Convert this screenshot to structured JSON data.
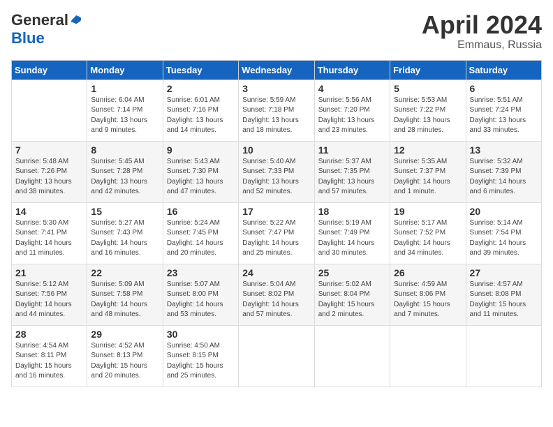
{
  "header": {
    "logo_general": "General",
    "logo_blue": "Blue",
    "title": "April 2024",
    "location": "Emmaus, Russia"
  },
  "calendar": {
    "days_of_week": [
      "Sunday",
      "Monday",
      "Tuesday",
      "Wednesday",
      "Thursday",
      "Friday",
      "Saturday"
    ],
    "weeks": [
      [
        {
          "day": "",
          "info": ""
        },
        {
          "day": "1",
          "info": "Sunrise: 6:04 AM\nSunset: 7:14 PM\nDaylight: 13 hours\nand 9 minutes."
        },
        {
          "day": "2",
          "info": "Sunrise: 6:01 AM\nSunset: 7:16 PM\nDaylight: 13 hours\nand 14 minutes."
        },
        {
          "day": "3",
          "info": "Sunrise: 5:59 AM\nSunset: 7:18 PM\nDaylight: 13 hours\nand 18 minutes."
        },
        {
          "day": "4",
          "info": "Sunrise: 5:56 AM\nSunset: 7:20 PM\nDaylight: 13 hours\nand 23 minutes."
        },
        {
          "day": "5",
          "info": "Sunrise: 5:53 AM\nSunset: 7:22 PM\nDaylight: 13 hours\nand 28 minutes."
        },
        {
          "day": "6",
          "info": "Sunrise: 5:51 AM\nSunset: 7:24 PM\nDaylight: 13 hours\nand 33 minutes."
        }
      ],
      [
        {
          "day": "7",
          "info": "Sunrise: 5:48 AM\nSunset: 7:26 PM\nDaylight: 13 hours\nand 38 minutes."
        },
        {
          "day": "8",
          "info": "Sunrise: 5:45 AM\nSunset: 7:28 PM\nDaylight: 13 hours\nand 42 minutes."
        },
        {
          "day": "9",
          "info": "Sunrise: 5:43 AM\nSunset: 7:30 PM\nDaylight: 13 hours\nand 47 minutes."
        },
        {
          "day": "10",
          "info": "Sunrise: 5:40 AM\nSunset: 7:33 PM\nDaylight: 13 hours\nand 52 minutes."
        },
        {
          "day": "11",
          "info": "Sunrise: 5:37 AM\nSunset: 7:35 PM\nDaylight: 13 hours\nand 57 minutes."
        },
        {
          "day": "12",
          "info": "Sunrise: 5:35 AM\nSunset: 7:37 PM\nDaylight: 14 hours\nand 1 minute."
        },
        {
          "day": "13",
          "info": "Sunrise: 5:32 AM\nSunset: 7:39 PM\nDaylight: 14 hours\nand 6 minutes."
        }
      ],
      [
        {
          "day": "14",
          "info": "Sunrise: 5:30 AM\nSunset: 7:41 PM\nDaylight: 14 hours\nand 11 minutes."
        },
        {
          "day": "15",
          "info": "Sunrise: 5:27 AM\nSunset: 7:43 PM\nDaylight: 14 hours\nand 16 minutes."
        },
        {
          "day": "16",
          "info": "Sunrise: 5:24 AM\nSunset: 7:45 PM\nDaylight: 14 hours\nand 20 minutes."
        },
        {
          "day": "17",
          "info": "Sunrise: 5:22 AM\nSunset: 7:47 PM\nDaylight: 14 hours\nand 25 minutes."
        },
        {
          "day": "18",
          "info": "Sunrise: 5:19 AM\nSunset: 7:49 PM\nDaylight: 14 hours\nand 30 minutes."
        },
        {
          "day": "19",
          "info": "Sunrise: 5:17 AM\nSunset: 7:52 PM\nDaylight: 14 hours\nand 34 minutes."
        },
        {
          "day": "20",
          "info": "Sunrise: 5:14 AM\nSunset: 7:54 PM\nDaylight: 14 hours\nand 39 minutes."
        }
      ],
      [
        {
          "day": "21",
          "info": "Sunrise: 5:12 AM\nSunset: 7:56 PM\nDaylight: 14 hours\nand 44 minutes."
        },
        {
          "day": "22",
          "info": "Sunrise: 5:09 AM\nSunset: 7:58 PM\nDaylight: 14 hours\nand 48 minutes."
        },
        {
          "day": "23",
          "info": "Sunrise: 5:07 AM\nSunset: 8:00 PM\nDaylight: 14 hours\nand 53 minutes."
        },
        {
          "day": "24",
          "info": "Sunrise: 5:04 AM\nSunset: 8:02 PM\nDaylight: 14 hours\nand 57 minutes."
        },
        {
          "day": "25",
          "info": "Sunrise: 5:02 AM\nSunset: 8:04 PM\nDaylight: 15 hours\nand 2 minutes."
        },
        {
          "day": "26",
          "info": "Sunrise: 4:59 AM\nSunset: 8:06 PM\nDaylight: 15 hours\nand 7 minutes."
        },
        {
          "day": "27",
          "info": "Sunrise: 4:57 AM\nSunset: 8:08 PM\nDaylight: 15 hours\nand 11 minutes."
        }
      ],
      [
        {
          "day": "28",
          "info": "Sunrise: 4:54 AM\nSunset: 8:11 PM\nDaylight: 15 hours\nand 16 minutes."
        },
        {
          "day": "29",
          "info": "Sunrise: 4:52 AM\nSunset: 8:13 PM\nDaylight: 15 hours\nand 20 minutes."
        },
        {
          "day": "30",
          "info": "Sunrise: 4:50 AM\nSunset: 8:15 PM\nDaylight: 15 hours\nand 25 minutes."
        },
        {
          "day": "",
          "info": ""
        },
        {
          "day": "",
          "info": ""
        },
        {
          "day": "",
          "info": ""
        },
        {
          "day": "",
          "info": ""
        }
      ]
    ]
  }
}
